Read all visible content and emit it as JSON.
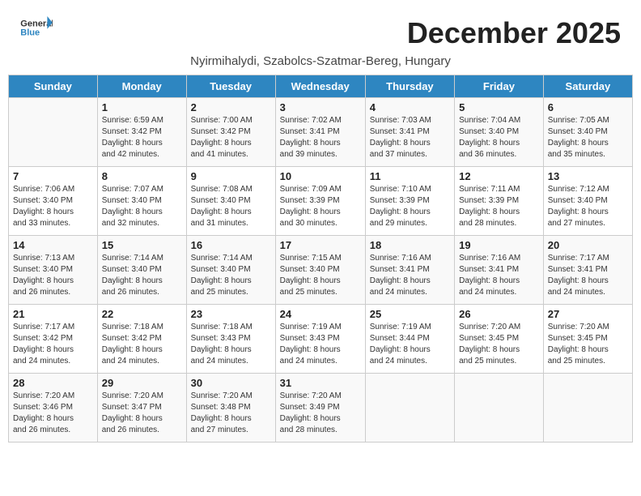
{
  "header": {
    "logo_general": "General",
    "logo_blue": "Blue",
    "month_title": "December 2025",
    "subtitle": "Nyirmihalydi, Szabolcs-Szatmar-Bereg, Hungary"
  },
  "days_of_week": [
    "Sunday",
    "Monday",
    "Tuesday",
    "Wednesday",
    "Thursday",
    "Friday",
    "Saturday"
  ],
  "weeks": [
    [
      {
        "num": "",
        "info": ""
      },
      {
        "num": "1",
        "info": "Sunrise: 6:59 AM\nSunset: 3:42 PM\nDaylight: 8 hours\nand 42 minutes."
      },
      {
        "num": "2",
        "info": "Sunrise: 7:00 AM\nSunset: 3:42 PM\nDaylight: 8 hours\nand 41 minutes."
      },
      {
        "num": "3",
        "info": "Sunrise: 7:02 AM\nSunset: 3:41 PM\nDaylight: 8 hours\nand 39 minutes."
      },
      {
        "num": "4",
        "info": "Sunrise: 7:03 AM\nSunset: 3:41 PM\nDaylight: 8 hours\nand 37 minutes."
      },
      {
        "num": "5",
        "info": "Sunrise: 7:04 AM\nSunset: 3:40 PM\nDaylight: 8 hours\nand 36 minutes."
      },
      {
        "num": "6",
        "info": "Sunrise: 7:05 AM\nSunset: 3:40 PM\nDaylight: 8 hours\nand 35 minutes."
      }
    ],
    [
      {
        "num": "7",
        "info": "Sunrise: 7:06 AM\nSunset: 3:40 PM\nDaylight: 8 hours\nand 33 minutes."
      },
      {
        "num": "8",
        "info": "Sunrise: 7:07 AM\nSunset: 3:40 PM\nDaylight: 8 hours\nand 32 minutes."
      },
      {
        "num": "9",
        "info": "Sunrise: 7:08 AM\nSunset: 3:40 PM\nDaylight: 8 hours\nand 31 minutes."
      },
      {
        "num": "10",
        "info": "Sunrise: 7:09 AM\nSunset: 3:39 PM\nDaylight: 8 hours\nand 30 minutes."
      },
      {
        "num": "11",
        "info": "Sunrise: 7:10 AM\nSunset: 3:39 PM\nDaylight: 8 hours\nand 29 minutes."
      },
      {
        "num": "12",
        "info": "Sunrise: 7:11 AM\nSunset: 3:39 PM\nDaylight: 8 hours\nand 28 minutes."
      },
      {
        "num": "13",
        "info": "Sunrise: 7:12 AM\nSunset: 3:40 PM\nDaylight: 8 hours\nand 27 minutes."
      }
    ],
    [
      {
        "num": "14",
        "info": "Sunrise: 7:13 AM\nSunset: 3:40 PM\nDaylight: 8 hours\nand 26 minutes."
      },
      {
        "num": "15",
        "info": "Sunrise: 7:14 AM\nSunset: 3:40 PM\nDaylight: 8 hours\nand 26 minutes."
      },
      {
        "num": "16",
        "info": "Sunrise: 7:14 AM\nSunset: 3:40 PM\nDaylight: 8 hours\nand 25 minutes."
      },
      {
        "num": "17",
        "info": "Sunrise: 7:15 AM\nSunset: 3:40 PM\nDaylight: 8 hours\nand 25 minutes."
      },
      {
        "num": "18",
        "info": "Sunrise: 7:16 AM\nSunset: 3:41 PM\nDaylight: 8 hours\nand 24 minutes."
      },
      {
        "num": "19",
        "info": "Sunrise: 7:16 AM\nSunset: 3:41 PM\nDaylight: 8 hours\nand 24 minutes."
      },
      {
        "num": "20",
        "info": "Sunrise: 7:17 AM\nSunset: 3:41 PM\nDaylight: 8 hours\nand 24 minutes."
      }
    ],
    [
      {
        "num": "21",
        "info": "Sunrise: 7:17 AM\nSunset: 3:42 PM\nDaylight: 8 hours\nand 24 minutes."
      },
      {
        "num": "22",
        "info": "Sunrise: 7:18 AM\nSunset: 3:42 PM\nDaylight: 8 hours\nand 24 minutes."
      },
      {
        "num": "23",
        "info": "Sunrise: 7:18 AM\nSunset: 3:43 PM\nDaylight: 8 hours\nand 24 minutes."
      },
      {
        "num": "24",
        "info": "Sunrise: 7:19 AM\nSunset: 3:43 PM\nDaylight: 8 hours\nand 24 minutes."
      },
      {
        "num": "25",
        "info": "Sunrise: 7:19 AM\nSunset: 3:44 PM\nDaylight: 8 hours\nand 24 minutes."
      },
      {
        "num": "26",
        "info": "Sunrise: 7:20 AM\nSunset: 3:45 PM\nDaylight: 8 hours\nand 25 minutes."
      },
      {
        "num": "27",
        "info": "Sunrise: 7:20 AM\nSunset: 3:45 PM\nDaylight: 8 hours\nand 25 minutes."
      }
    ],
    [
      {
        "num": "28",
        "info": "Sunrise: 7:20 AM\nSunset: 3:46 PM\nDaylight: 8 hours\nand 26 minutes."
      },
      {
        "num": "29",
        "info": "Sunrise: 7:20 AM\nSunset: 3:47 PM\nDaylight: 8 hours\nand 26 minutes."
      },
      {
        "num": "30",
        "info": "Sunrise: 7:20 AM\nSunset: 3:48 PM\nDaylight: 8 hours\nand 27 minutes."
      },
      {
        "num": "31",
        "info": "Sunrise: 7:20 AM\nSunset: 3:49 PM\nDaylight: 8 hours\nand 28 minutes."
      },
      {
        "num": "",
        "info": ""
      },
      {
        "num": "",
        "info": ""
      },
      {
        "num": "",
        "info": ""
      }
    ]
  ]
}
